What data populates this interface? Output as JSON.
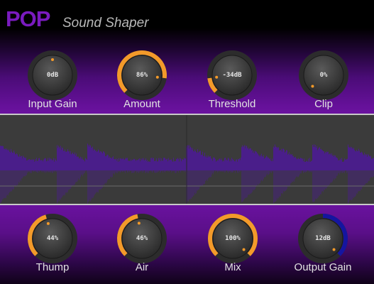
{
  "header": {
    "logo": "POP",
    "product": "Sound Shaper"
  },
  "colors": {
    "accent": "#f39a2a",
    "output_accent": "#1515a0",
    "panel": "#6a129f",
    "logo": "#7a1bbf"
  },
  "top_knobs": [
    {
      "id": "input-gain",
      "label": "Input Gain",
      "value": "0dB",
      "position": 0.5,
      "arc": "center"
    },
    {
      "id": "amount",
      "label": "Amount",
      "value": "86%",
      "position": 0.86,
      "arc": "min"
    },
    {
      "id": "threshold",
      "label": "Threshold",
      "value": "-34dB",
      "position": 0.14,
      "arc": "min"
    },
    {
      "id": "clip",
      "label": "Clip",
      "value": "0%",
      "position": 0.0,
      "arc": "min"
    }
  ],
  "bottom_knobs": [
    {
      "id": "thump",
      "label": "Thump",
      "value": "44%",
      "position": 0.44,
      "arc": "min"
    },
    {
      "id": "air",
      "label": "Air",
      "value": "46%",
      "position": 0.46,
      "arc": "min"
    },
    {
      "id": "mix",
      "label": "Mix",
      "value": "100%",
      "position": 1.0,
      "arc": "min"
    },
    {
      "id": "output-gain",
      "label": "Output Gain",
      "value": "12dB",
      "position": 1.0,
      "arc": "center",
      "accent": "output"
    }
  ]
}
